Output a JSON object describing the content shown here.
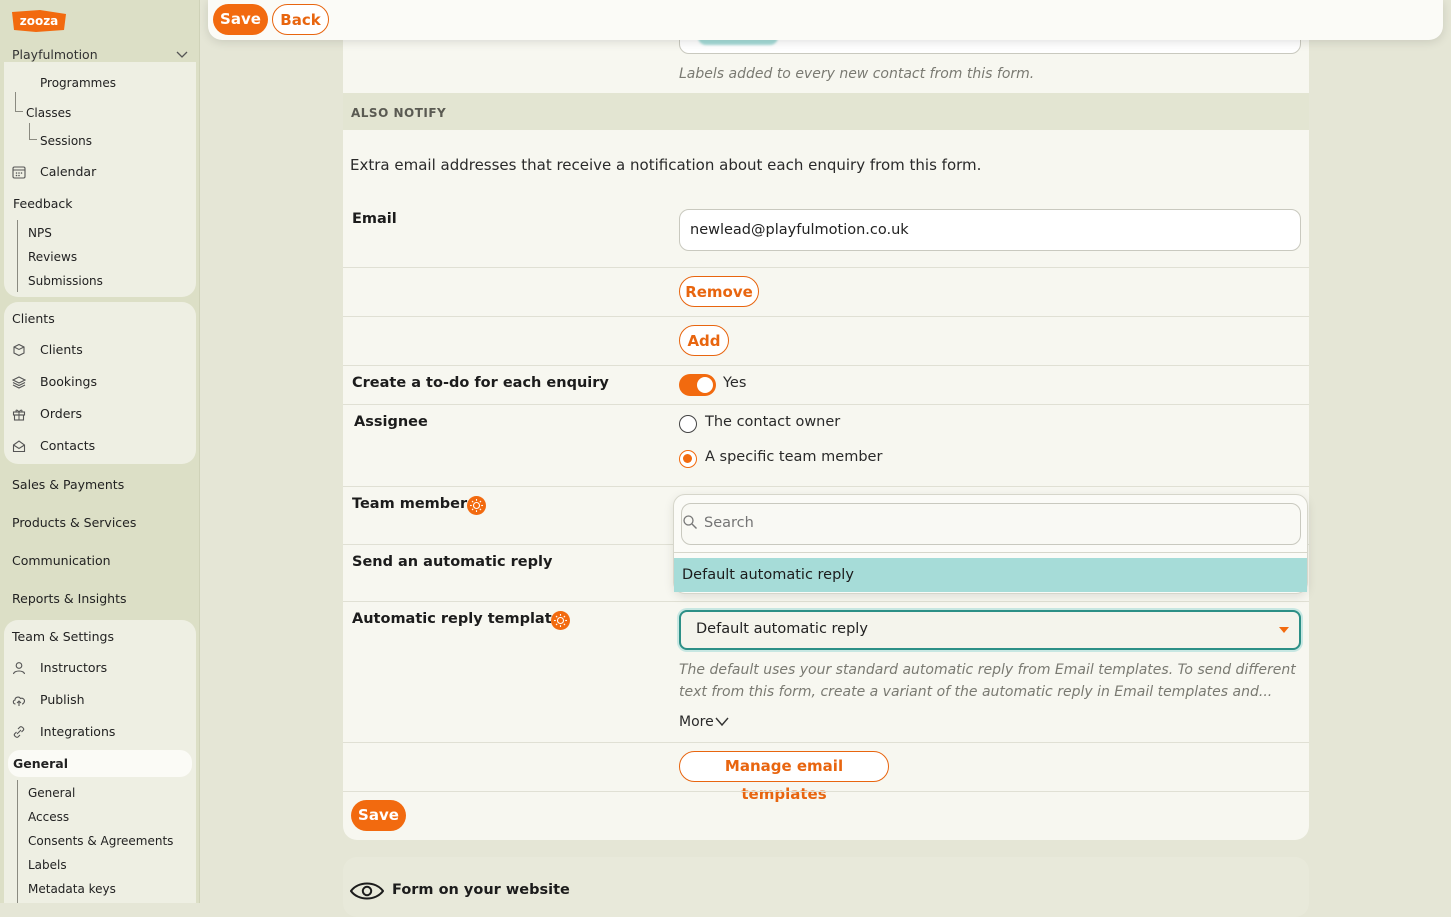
{
  "app": {
    "logo_text": "zooza",
    "organisation": "Playfulmotion"
  },
  "colors": {
    "accent": "#f26a0f",
    "highlight": "#a6dcd8",
    "focus_border": "#2c8f86",
    "sidebar_bg": "#dcdfc6"
  },
  "sidebar": {
    "programmes": "Programmes",
    "classes": "Classes",
    "sessions": "Sessions",
    "calendar": "Calendar",
    "feedback": "Feedback",
    "nps": "NPS",
    "reviews": "Reviews",
    "submissions": "Submissions",
    "clients_header": "Clients",
    "clients": "Clients",
    "bookings": "Bookings",
    "orders": "Orders",
    "contacts": "Contacts",
    "sales_payments": "Sales & Payments",
    "products_services": "Products & Services",
    "communication": "Communication",
    "reports_insights": "Reports & Insights",
    "team_settings": "Team & Settings",
    "instructors": "Instructors",
    "publish": "Publish",
    "integrations": "Integrations",
    "general_header": "General",
    "general": "General",
    "access": "Access",
    "consents": "Consents & Agreements",
    "labels": "Labels",
    "metadata_keys": "Metadata keys"
  },
  "toolbar": {
    "save_label": "Save",
    "back_label": "Back"
  },
  "form": {
    "labels_hint": "Labels added to every new contact from this form.",
    "also_notify_heading": "ALSO NOTIFY",
    "also_notify_desc": "Extra email addresses that receive a notification about each enquiry from this form.",
    "email_label": "Email",
    "email_value": "newlead@playfulmotion.co.uk",
    "remove_label": "Remove",
    "add_label": "Add",
    "todo_label": "Create a to-do for each enquiry",
    "todo_value": "Yes",
    "todo_enabled": true,
    "assignee_label": "Assignee",
    "assignee_options": [
      "The contact owner",
      "A specific team member"
    ],
    "assignee_selected": "A specific team member",
    "team_member_label": "Team member",
    "auto_reply_label": "Send an automatic reply",
    "search_placeholder": "Search",
    "dropdown_option": "Default automatic reply",
    "template_label": "Automatic reply template",
    "template_value": "Default automatic reply",
    "template_hint_line1": "The default uses your standard automatic reply from Email templates. To send different",
    "template_hint_line2": "text from this form, create a variant of the automatic reply in Email templates and...",
    "more_label": "More",
    "manage_templates_label": "Manage email templates",
    "save_label": "Save"
  },
  "website_section": {
    "title": "Form on your website"
  }
}
